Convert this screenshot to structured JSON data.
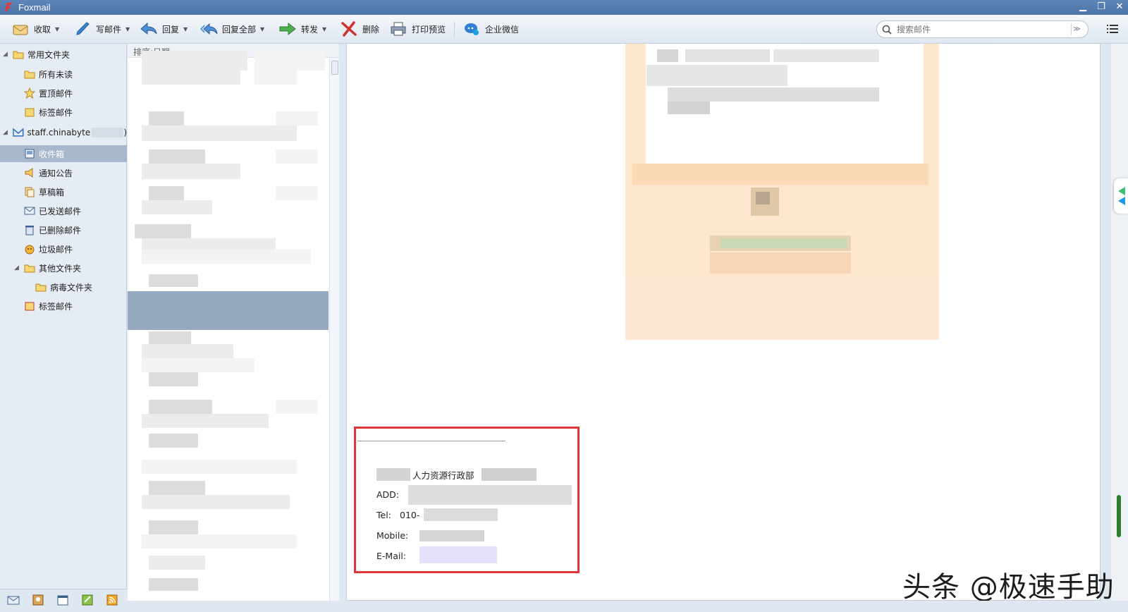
{
  "window": {
    "title": "Foxmail"
  },
  "toolbar": {
    "receive": "收取",
    "compose": "写邮件",
    "reply": "回复",
    "reply_all": "回复全部",
    "forward": "转发",
    "delete": "删除",
    "print_preview": "打印预览",
    "wecom": "企业微信"
  },
  "search": {
    "placeholder": "搜索邮件"
  },
  "sidebar": {
    "common_folders": "常用文件夹",
    "all_unread": "所有未读",
    "pinned": "置顶邮件",
    "tagged": "标签邮件",
    "account_name": "staff.chinabyte",
    "account_suffix": ")",
    "inbox": "收件箱",
    "notices": "通知公告",
    "drafts": "草稿箱",
    "sent": "已发送邮件",
    "deleted": "已删除邮件",
    "spam": "垃圾邮件",
    "other_folders": "其他文件夹",
    "virus_folder": "病毒文件夹",
    "tagged_mail": "标签邮件"
  },
  "maillist": {
    "sort_label": "排序:日期"
  },
  "signature": {
    "department": "人力资源行政部",
    "add_label": "ADD:",
    "tel_label": "Tel:",
    "tel_prefix": "010-",
    "mobile_label": "Mobile:",
    "email_label": "E-Mail:"
  },
  "watermark": "头条 @极速手助",
  "icons": [
    "receive-icon",
    "compose-icon",
    "reply-icon",
    "reply-all-icon",
    "forward-icon",
    "delete-icon",
    "print-icon",
    "wecom-icon",
    "search-icon",
    "menu-icon",
    "folder-icon",
    "star-icon",
    "inbox-icon",
    "trash-icon"
  ],
  "colors": {
    "highlight_box": "#e0363b",
    "selected_mail": "#97a9c0",
    "titlebar": "#5479ad"
  }
}
